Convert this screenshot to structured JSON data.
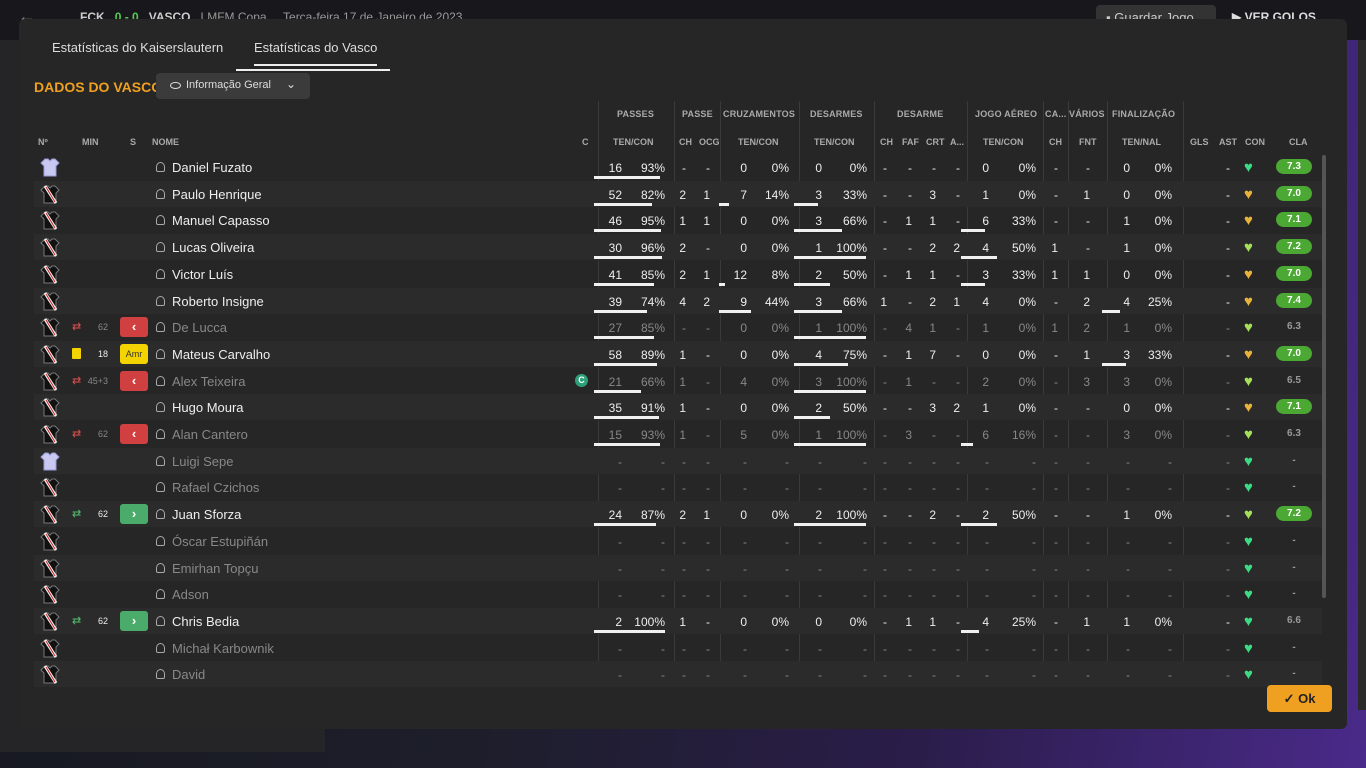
{
  "topbar": {
    "home_abbr": "FCK",
    "score": "0 - 0",
    "away": "VASCO",
    "competition": "LMFM Copa",
    "date": "Terça-feira 17 de Janeiro de 2023",
    "save_label": "Guardar Jogo",
    "goals_label": "VER GOLOS"
  },
  "tabs": [
    {
      "label": "Estatísticas do Kaiserslautern",
      "active": false
    },
    {
      "label": "Estatísticas do Vasco",
      "active": true
    }
  ],
  "section_title": "DADOS DO VASCO",
  "view_dropdown": {
    "selected": "Informação Geral"
  },
  "group_headers": {
    "passes": "PASSES",
    "passe": "PASSE",
    "cruzamentos": "CRUZAMENTOS",
    "desarmes": "DESARMES",
    "desarme": "DESARME",
    "jogo_aereo": "JOGO AÉREO",
    "ca": "CA...",
    "varios": "VÁRIOS",
    "finalizacao": "FINALIZAÇÃO"
  },
  "columns": {
    "n": "Nº",
    "min": "MIN",
    "s": "S",
    "nome": "NOME",
    "c": "C",
    "passes_tc": "TEN/CON",
    "ch": "CH",
    "ocg": "OCG",
    "cruz_tc": "TEN/CON",
    "des_tc": "TEN/CON",
    "dch": "CH",
    "faf": "FAF",
    "crt": "CRT",
    "a": "A...",
    "ja_tc": "TEN/CON",
    "cach": "CH",
    "fnt": "FNT",
    "fin_tn": "TEN/NAL",
    "gls": "GLS",
    "ast": "AST",
    "con": "CON",
    "cla": "CLA"
  },
  "players": [
    {
      "name": "Daniel Fuzato",
      "gk": true,
      "min": "",
      "sub": "",
      "dim": false,
      "captain": false,
      "p": [
        "16",
        "93%"
      ],
      "pch": "-",
      "pocg": "-",
      "cr": [
        "0",
        "0%"
      ],
      "de": [
        "0",
        "0%"
      ],
      "dch": "-",
      "faf": "-",
      "crt": "-",
      "a": "-",
      "ja": [
        "0",
        "0%"
      ],
      "cach": "-",
      "fnt": "-",
      "fin": [
        "0",
        "0%"
      ],
      "gls": "",
      "ast": "-",
      "cla": "7.3",
      "heart": "green"
    },
    {
      "name": "Paulo Henrique",
      "gk": false,
      "min": "",
      "sub": "",
      "dim": false,
      "captain": false,
      "p": [
        "52",
        "82%"
      ],
      "pch": "2",
      "pocg": "1",
      "cr": [
        "7",
        "14%"
      ],
      "de": [
        "3",
        "33%"
      ],
      "dch": "-",
      "faf": "-",
      "crt": "3",
      "a": "-",
      "ja": [
        "1",
        "0%"
      ],
      "cach": "-",
      "fnt": "1",
      "fin": [
        "0",
        "0%"
      ],
      "gls": "",
      "ast": "-",
      "cla": "7.0",
      "heart": "yellow"
    },
    {
      "name": "Manuel Capasso",
      "gk": false,
      "min": "",
      "sub": "",
      "dim": false,
      "captain": false,
      "p": [
        "46",
        "95%"
      ],
      "pch": "1",
      "pocg": "1",
      "cr": [
        "0",
        "0%"
      ],
      "de": [
        "3",
        "66%"
      ],
      "dch": "-",
      "faf": "1",
      "crt": "1",
      "a": "-",
      "ja": [
        "6",
        "33%"
      ],
      "cach": "-",
      "fnt": "-",
      "fin": [
        "1",
        "0%"
      ],
      "gls": "",
      "ast": "-",
      "cla": "7.1",
      "heart": "yellow"
    },
    {
      "name": "Lucas Oliveira",
      "gk": false,
      "min": "",
      "sub": "",
      "dim": false,
      "captain": false,
      "p": [
        "30",
        "96%"
      ],
      "pch": "2",
      "pocg": "-",
      "cr": [
        "0",
        "0%"
      ],
      "de": [
        "1",
        "100%"
      ],
      "dch": "-",
      "faf": "-",
      "crt": "2",
      "a": "2",
      "ja": [
        "4",
        "50%"
      ],
      "cach": "1",
      "fnt": "-",
      "fin": [
        "1",
        "0%"
      ],
      "gls": "",
      "ast": "-",
      "cla": "7.2",
      "heart": "lime"
    },
    {
      "name": "Victor Luís",
      "gk": false,
      "min": "",
      "sub": "",
      "dim": false,
      "captain": false,
      "p": [
        "41",
        "85%"
      ],
      "pch": "2",
      "pocg": "1",
      "cr": [
        "12",
        "8%"
      ],
      "de": [
        "2",
        "50%"
      ],
      "dch": "-",
      "faf": "1",
      "crt": "1",
      "a": "-",
      "ja": [
        "3",
        "33%"
      ],
      "cach": "1",
      "fnt": "1",
      "fin": [
        "0",
        "0%"
      ],
      "gls": "",
      "ast": "-",
      "cla": "7.0",
      "heart": "yellow"
    },
    {
      "name": "Roberto Insigne",
      "gk": false,
      "min": "",
      "sub": "",
      "dim": false,
      "captain": false,
      "p": [
        "39",
        "74%"
      ],
      "pch": "4",
      "pocg": "2",
      "cr": [
        "9",
        "44%"
      ],
      "de": [
        "3",
        "66%"
      ],
      "dch": "1",
      "faf": "-",
      "crt": "2",
      "a": "1",
      "ja": [
        "4",
        "0%"
      ],
      "cach": "-",
      "fnt": "2",
      "fin": [
        "4",
        "25%"
      ],
      "gls": "",
      "ast": "-",
      "cla": "7.4",
      "heart": "yellow"
    },
    {
      "name": "De Lucca",
      "gk": false,
      "min": "62",
      "sub": "out",
      "dim": true,
      "captain": false,
      "p": [
        "27",
        "85%"
      ],
      "pch": "-",
      "pocg": "-",
      "cr": [
        "0",
        "0%"
      ],
      "de": [
        "1",
        "100%"
      ],
      "dch": "-",
      "faf": "4",
      "crt": "1",
      "a": "-",
      "ja": [
        "1",
        "0%"
      ],
      "cach": "1",
      "fnt": "2",
      "fin": [
        "1",
        "0%"
      ],
      "gls": "",
      "ast": "-",
      "cla": "6.3",
      "heart": "lime"
    },
    {
      "name": "Mateus Carvalho",
      "gk": false,
      "min": "18",
      "sub": "yel",
      "dim": false,
      "captain": false,
      "p": [
        "58",
        "89%"
      ],
      "pch": "1",
      "pocg": "-",
      "cr": [
        "0",
        "0%"
      ],
      "de": [
        "4",
        "75%"
      ],
      "dch": "-",
      "faf": "1",
      "crt": "7",
      "a": "-",
      "ja": [
        "0",
        "0%"
      ],
      "cach": "-",
      "fnt": "1",
      "fin": [
        "3",
        "33%"
      ],
      "gls": "",
      "ast": "-",
      "cla": "7.0",
      "heart": "yellow"
    },
    {
      "name": "Alex Teixeira",
      "gk": false,
      "min": "45+3",
      "sub": "out",
      "dim": true,
      "captain": true,
      "p": [
        "21",
        "66%"
      ],
      "pch": "1",
      "pocg": "-",
      "cr": [
        "4",
        "0%"
      ],
      "de": [
        "3",
        "100%"
      ],
      "dch": "-",
      "faf": "1",
      "crt": "-",
      "a": "-",
      "ja": [
        "2",
        "0%"
      ],
      "cach": "-",
      "fnt": "3",
      "fin": [
        "3",
        "0%"
      ],
      "gls": "",
      "ast": "-",
      "cla": "6.5",
      "heart": "lime"
    },
    {
      "name": "Hugo Moura",
      "gk": false,
      "min": "",
      "sub": "",
      "dim": false,
      "captain": false,
      "p": [
        "35",
        "91%"
      ],
      "pch": "1",
      "pocg": "-",
      "cr": [
        "0",
        "0%"
      ],
      "de": [
        "2",
        "50%"
      ],
      "dch": "-",
      "faf": "-",
      "crt": "3",
      "a": "2",
      "ja": [
        "1",
        "0%"
      ],
      "cach": "-",
      "fnt": "-",
      "fin": [
        "0",
        "0%"
      ],
      "gls": "",
      "ast": "-",
      "cla": "7.1",
      "heart": "yellow"
    },
    {
      "name": "Alan Cantero",
      "gk": false,
      "min": "62",
      "sub": "out",
      "dim": true,
      "captain": false,
      "p": [
        "15",
        "93%"
      ],
      "pch": "1",
      "pocg": "-",
      "cr": [
        "5",
        "0%"
      ],
      "de": [
        "1",
        "100%"
      ],
      "dch": "-",
      "faf": "3",
      "crt": "-",
      "a": "-",
      "ja": [
        "6",
        "16%"
      ],
      "cach": "-",
      "fnt": "-",
      "fin": [
        "3",
        "0%"
      ],
      "gls": "",
      "ast": "-",
      "cla": "6.3",
      "heart": "lime"
    },
    {
      "name": "Luigi Sepe",
      "gk": true,
      "min": "",
      "sub": "",
      "dim": true,
      "captain": false,
      "p": [
        "-",
        "-"
      ],
      "pch": "-",
      "pocg": "-",
      "cr": [
        "-",
        "-"
      ],
      "de": [
        "-",
        "-"
      ],
      "dch": "-",
      "faf": "-",
      "crt": "-",
      "a": "-",
      "ja": [
        "-",
        "-"
      ],
      "cach": "-",
      "fnt": "-",
      "fin": [
        "-",
        "-"
      ],
      "gls": "",
      "ast": "-",
      "cla": "-",
      "heart": "green"
    },
    {
      "name": "Rafael Czichos",
      "gk": false,
      "min": "",
      "sub": "",
      "dim": true,
      "captain": false,
      "p": [
        "-",
        "-"
      ],
      "pch": "-",
      "pocg": "-",
      "cr": [
        "-",
        "-"
      ],
      "de": [
        "-",
        "-"
      ],
      "dch": "-",
      "faf": "-",
      "crt": "-",
      "a": "-",
      "ja": [
        "-",
        "-"
      ],
      "cach": "-",
      "fnt": "-",
      "fin": [
        "-",
        "-"
      ],
      "gls": "",
      "ast": "-",
      "cla": "-",
      "heart": "green"
    },
    {
      "name": "Juan Sforza",
      "gk": false,
      "min": "62",
      "sub": "in",
      "dim": false,
      "captain": false,
      "p": [
        "24",
        "87%"
      ],
      "pch": "2",
      "pocg": "1",
      "cr": [
        "0",
        "0%"
      ],
      "de": [
        "2",
        "100%"
      ],
      "dch": "-",
      "faf": "-",
      "crt": "2",
      "a": "-",
      "ja": [
        "2",
        "50%"
      ],
      "cach": "-",
      "fnt": "-",
      "fin": [
        "1",
        "0%"
      ],
      "gls": "",
      "ast": "-",
      "cla": "7.2",
      "heart": "lime"
    },
    {
      "name": "Óscar Estupiñán",
      "gk": false,
      "min": "",
      "sub": "",
      "dim": true,
      "captain": false,
      "p": [
        "-",
        "-"
      ],
      "pch": "-",
      "pocg": "-",
      "cr": [
        "-",
        "-"
      ],
      "de": [
        "-",
        "-"
      ],
      "dch": "-",
      "faf": "-",
      "crt": "-",
      "a": "-",
      "ja": [
        "-",
        "-"
      ],
      "cach": "-",
      "fnt": "-",
      "fin": [
        "-",
        "-"
      ],
      "gls": "",
      "ast": "-",
      "cla": "-",
      "heart": "green"
    },
    {
      "name": "Emirhan Topçu",
      "gk": false,
      "min": "",
      "sub": "",
      "dim": true,
      "captain": false,
      "p": [
        "-",
        "-"
      ],
      "pch": "-",
      "pocg": "-",
      "cr": [
        "-",
        "-"
      ],
      "de": [
        "-",
        "-"
      ],
      "dch": "-",
      "faf": "-",
      "crt": "-",
      "a": "-",
      "ja": [
        "-",
        "-"
      ],
      "cach": "-",
      "fnt": "-",
      "fin": [
        "-",
        "-"
      ],
      "gls": "",
      "ast": "-",
      "cla": "-",
      "heart": "green"
    },
    {
      "name": "Adson",
      "gk": false,
      "min": "",
      "sub": "",
      "dim": true,
      "captain": false,
      "p": [
        "-",
        "-"
      ],
      "pch": "-",
      "pocg": "-",
      "cr": [
        "-",
        "-"
      ],
      "de": [
        "-",
        "-"
      ],
      "dch": "-",
      "faf": "-",
      "crt": "-",
      "a": "-",
      "ja": [
        "-",
        "-"
      ],
      "cach": "-",
      "fnt": "-",
      "fin": [
        "-",
        "-"
      ],
      "gls": "",
      "ast": "-",
      "cla": "-",
      "heart": "green"
    },
    {
      "name": "Chris Bedia",
      "gk": false,
      "min": "62",
      "sub": "in",
      "dim": false,
      "captain": false,
      "p": [
        "2",
        "100%"
      ],
      "pch": "1",
      "pocg": "-",
      "cr": [
        "0",
        "0%"
      ],
      "de": [
        "0",
        "0%"
      ],
      "dch": "-",
      "faf": "1",
      "crt": "1",
      "a": "-",
      "ja": [
        "4",
        "25%"
      ],
      "cach": "-",
      "fnt": "1",
      "fin": [
        "1",
        "0%"
      ],
      "gls": "",
      "ast": "-",
      "cla": "6.6",
      "heart": "green"
    },
    {
      "name": "Michał Karbownik",
      "gk": false,
      "min": "",
      "sub": "",
      "dim": true,
      "captain": false,
      "p": [
        "-",
        "-"
      ],
      "pch": "-",
      "pocg": "-",
      "cr": [
        "-",
        "-"
      ],
      "de": [
        "-",
        "-"
      ],
      "dch": "-",
      "faf": "-",
      "crt": "-",
      "a": "-",
      "ja": [
        "-",
        "-"
      ],
      "cach": "-",
      "fnt": "-",
      "fin": [
        "-",
        "-"
      ],
      "gls": "",
      "ast": "-",
      "cla": "-",
      "heart": "green"
    },
    {
      "name": "David",
      "gk": false,
      "min": "",
      "sub": "",
      "dim": true,
      "captain": false,
      "p": [
        "-",
        "-"
      ],
      "pch": "-",
      "pocg": "-",
      "cr": [
        "-",
        "-"
      ],
      "de": [
        "-",
        "-"
      ],
      "dch": "-",
      "faf": "-",
      "crt": "-",
      "a": "-",
      "ja": [
        "-",
        "-"
      ],
      "cach": "-",
      "fnt": "-",
      "fin": [
        "-",
        "-"
      ],
      "gls": "",
      "ast": "-",
      "cla": "-",
      "heart": "green"
    }
  ],
  "sub_out_glyph": "‹",
  "sub_in_glyph": "›",
  "yellow_card_label": "Amr",
  "captain_label": "C",
  "ok_label": "Ok",
  "colors": {
    "accent": "#f0a020",
    "rating_bg": "#4aa833",
    "heart_green": "#3ddc84",
    "heart_lime": "#a6e05a",
    "heart_yellow": "#e8b33a"
  }
}
